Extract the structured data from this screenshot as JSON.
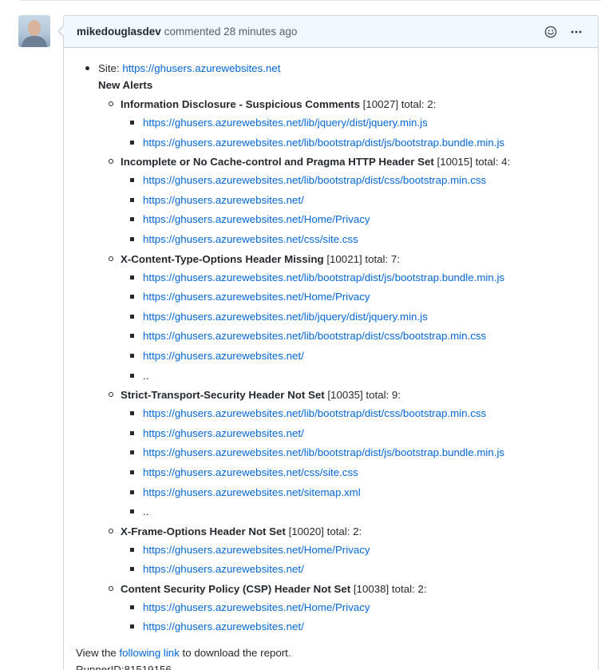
{
  "comment": {
    "author": "mikedouglasdev",
    "action_text": "commented",
    "timestamp": "28 minutes ago",
    "icons": {
      "reaction": "smiley-icon",
      "more": "kebab-horizontal-icon"
    }
  },
  "body": {
    "site_label": "Site:",
    "site_url": "https://ghusers.azurewebsites.net",
    "new_alerts_heading": "New Alerts",
    "alerts": [
      {
        "name": "Information Disclosure - Suspicious Comments",
        "meta": " [10027] total: 2:",
        "links": [
          "https://ghusers.azurewebsites.net/lib/jquery/dist/jquery.min.js",
          "https://ghusers.azurewebsites.net/lib/bootstrap/dist/js/bootstrap.bundle.min.js"
        ]
      },
      {
        "name": "Incomplete or No Cache-control and Pragma HTTP Header Set",
        "meta": " [10015] total: 4:",
        "links": [
          "https://ghusers.azurewebsites.net/lib/bootstrap/dist/css/bootstrap.min.css",
          "https://ghusers.azurewebsites.net/",
          "https://ghusers.azurewebsites.net/Home/Privacy",
          "https://ghusers.azurewebsites.net/css/site.css"
        ]
      },
      {
        "name": "X-Content-Type-Options Header Missing",
        "meta": " [10021] total: 7:",
        "links": [
          "https://ghusers.azurewebsites.net/lib/bootstrap/dist/js/bootstrap.bundle.min.js",
          "https://ghusers.azurewebsites.net/Home/Privacy",
          "https://ghusers.azurewebsites.net/lib/jquery/dist/jquery.min.js",
          "https://ghusers.azurewebsites.net/lib/bootstrap/dist/css/bootstrap.min.css",
          "https://ghusers.azurewebsites.net/",
          ".."
        ]
      },
      {
        "name": "Strict-Transport-Security Header Not Set",
        "meta": " [10035] total: 9:",
        "links": [
          "https://ghusers.azurewebsites.net/lib/bootstrap/dist/css/bootstrap.min.css",
          "https://ghusers.azurewebsites.net/",
          "https://ghusers.azurewebsites.net/lib/bootstrap/dist/js/bootstrap.bundle.min.js",
          "https://ghusers.azurewebsites.net/css/site.css",
          "https://ghusers.azurewebsites.net/sitemap.xml",
          ".."
        ]
      },
      {
        "name": "X-Frame-Options Header Not Set",
        "meta": " [10020] total: 2:",
        "links": [
          "https://ghusers.azurewebsites.net/Home/Privacy",
          "https://ghusers.azurewebsites.net/"
        ]
      },
      {
        "name": "Content Security Policy (CSP) Header Not Set",
        "meta": " [10038] total: 2:",
        "links": [
          "https://ghusers.azurewebsites.net/Home/Privacy",
          "https://ghusers.azurewebsites.net/"
        ]
      }
    ],
    "footer": {
      "view_prefix": "View the ",
      "link_text": "following link",
      "view_suffix": " to download the report.",
      "runner_id": "RunnerID:81519156"
    }
  }
}
